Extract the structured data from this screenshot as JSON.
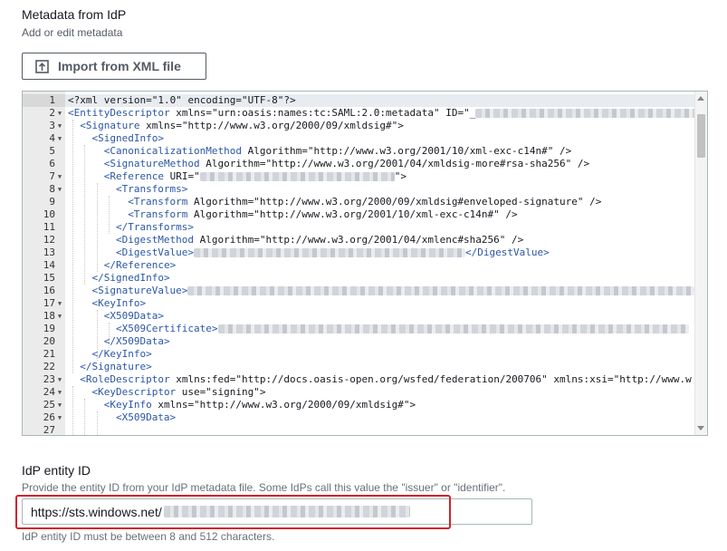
{
  "section": {
    "title": "Metadata from IdP",
    "description": "Add or edit metadata",
    "import_button_label": "Import from XML file"
  },
  "editor": {
    "lines": [
      {
        "n": "1",
        "fold": false,
        "active": true,
        "segments": [
          {
            "t": "<?xml version=\"1.0\" encoding=\"UTF-8\"?>"
          }
        ]
      },
      {
        "n": "2",
        "fold": true,
        "segments": [
          {
            "t": "<EntityDescriptor",
            "tag": true
          },
          {
            "t": " xmlns=\"urn:oasis:names:tc:SAML:2.0:metadata\" ID=\"_"
          },
          {
            "blur": true
          }
        ]
      },
      {
        "n": "3",
        "fold": true,
        "segments": [
          {
            "t": "<Signature",
            "tag": true
          },
          {
            "t": " xmlns=\"http://www.w3.org/2000/09/xmldsig#\">"
          }
        ]
      },
      {
        "n": "4",
        "fold": true,
        "segments": [
          {
            "t": "<SignedInfo>",
            "tag": true
          }
        ]
      },
      {
        "n": "5",
        "fold": false,
        "segments": [
          {
            "t": "<CanonicalizationMethod",
            "tag": true
          },
          {
            "t": " Algorithm=\"http://www.w3.org/2001/10/xml-exc-c14n#\" />"
          }
        ]
      },
      {
        "n": "6",
        "fold": false,
        "segments": [
          {
            "t": "<SignatureMethod",
            "tag": true
          },
          {
            "t": " Algorithm=\"http://www.w3.org/2001/04/xmldsig-more#rsa-sha256\" />"
          }
        ]
      },
      {
        "n": "7",
        "fold": true,
        "segments": [
          {
            "t": "<Reference",
            "tag": true
          },
          {
            "t": " URI=\""
          },
          {
            "blur": true
          },
          {
            "t": "\">"
          }
        ]
      },
      {
        "n": "8",
        "fold": true,
        "segments": [
          {
            "t": "<Transforms>",
            "tag": true
          }
        ]
      },
      {
        "n": "9",
        "fold": false,
        "segments": [
          {
            "t": "<Transform",
            "tag": true
          },
          {
            "t": " Algorithm=\"http://www.w3.org/2000/09/xmldsig#enveloped-signature\" />"
          }
        ]
      },
      {
        "n": "10",
        "fold": false,
        "segments": [
          {
            "t": "<Transform",
            "tag": true
          },
          {
            "t": " Algorithm=\"http://www.w3.org/2001/10/xml-exc-c14n#\" />"
          }
        ]
      },
      {
        "n": "11",
        "fold": false,
        "segments": [
          {
            "t": "</Transforms>",
            "tag": true
          }
        ]
      },
      {
        "n": "12",
        "fold": false,
        "segments": [
          {
            "t": "<DigestMethod",
            "tag": true
          },
          {
            "t": " Algorithm=\"http://www.w3.org/2001/04/xmlenc#sha256\" />"
          }
        ]
      },
      {
        "n": "13",
        "fold": false,
        "segments": [
          {
            "t": "<DigestValue>",
            "tag": true
          },
          {
            "blur": true
          },
          {
            "t": "</DigestValue>",
            "tag": true
          }
        ]
      },
      {
        "n": "14",
        "fold": false,
        "segments": [
          {
            "t": "</Reference>",
            "tag": true
          }
        ]
      },
      {
        "n": "15",
        "fold": false,
        "segments": [
          {
            "t": "</SignedInfo>",
            "tag": true
          }
        ]
      },
      {
        "n": "16",
        "fold": false,
        "segments": [
          {
            "t": "<SignatureValue>",
            "tag": true
          },
          {
            "blur": true
          }
        ]
      },
      {
        "n": "17",
        "fold": true,
        "segments": [
          {
            "t": "<KeyInfo>",
            "tag": true
          }
        ]
      },
      {
        "n": "18",
        "fold": true,
        "segments": [
          {
            "t": "<X509Data>",
            "tag": true
          }
        ]
      },
      {
        "n": "19",
        "fold": false,
        "segments": [
          {
            "t": "<X509Certificate>",
            "tag": true
          },
          {
            "blur": true
          }
        ]
      },
      {
        "n": "20",
        "fold": false,
        "segments": [
          {
            "t": "</X509Data>",
            "tag": true
          }
        ]
      },
      {
        "n": "21",
        "fold": false,
        "segments": [
          {
            "t": "</KeyInfo>",
            "tag": true
          }
        ]
      },
      {
        "n": "22",
        "fold": false,
        "segments": [
          {
            "t": "</Signature>",
            "tag": true
          }
        ]
      },
      {
        "n": "23",
        "fold": true,
        "segments": [
          {
            "t": "<RoleDescriptor",
            "tag": true
          },
          {
            "t": " xmlns:fed=\"http://docs.oasis-open.org/wsfed/federation/200706\" xmlns:xsi=\"http://www.w"
          }
        ]
      },
      {
        "n": "24",
        "fold": true,
        "segments": [
          {
            "t": "<KeyDescriptor",
            "tag": true
          },
          {
            "t": " use=\"signing\">"
          }
        ]
      },
      {
        "n": "25",
        "fold": true,
        "segments": [
          {
            "t": "<KeyInfo",
            "tag": true
          },
          {
            "t": " xmlns=\"http://www.w3.org/2000/09/xmldsig#\">"
          }
        ]
      },
      {
        "n": "26",
        "fold": true,
        "segments": [
          {
            "t": "<X509Data>",
            "tag": true
          }
        ]
      },
      {
        "n": "27",
        "fold": false,
        "segments": []
      }
    ]
  },
  "entity_id": {
    "label": "IdP entity ID",
    "description": "Provide the entity ID from your IdP metadata file. Some IdPs call this value the \"issuer\" or \"identifier\".",
    "value": "https://sts.windows.net/",
    "constraint": "IdP entity ID must be between 8 and 512 characters."
  },
  "colors": {
    "highlight_border": "#d0242b",
    "xml_tag": "#2a56a6"
  }
}
